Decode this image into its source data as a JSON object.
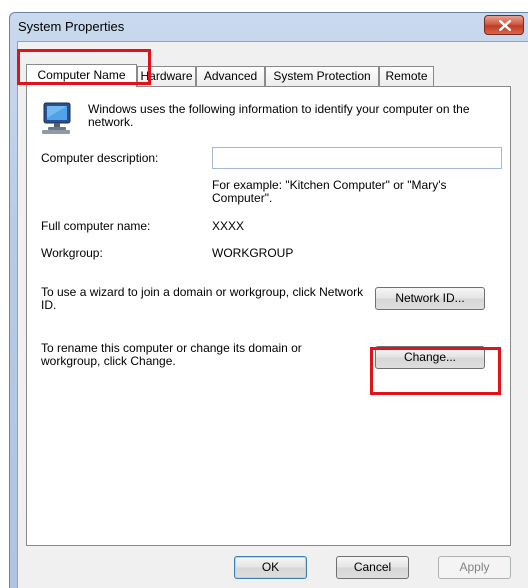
{
  "window": {
    "title": "System Properties"
  },
  "tabs": [
    {
      "label": "Computer Name",
      "active": true
    },
    {
      "label": "Hardware",
      "active": false
    },
    {
      "label": "Advanced",
      "active": false
    },
    {
      "label": "System Protection",
      "active": false
    },
    {
      "label": "Remote",
      "active": false
    }
  ],
  "panel": {
    "intro": "Windows uses the following information to identify your computer on the network.",
    "description_label": "Computer description:",
    "description_value": "",
    "example_text": "For example: \"Kitchen Computer\" or \"Mary's Computer\".",
    "full_name_label": "Full computer name:",
    "full_name_value": "XXXX",
    "workgroup_label": "Workgroup:",
    "workgroup_value": "WORKGROUP",
    "network_id_text": "To use a wizard to join a domain or workgroup, click Network ID.",
    "network_id_button": "Network ID...",
    "rename_text": "To rename this computer or change its domain or workgroup, click Change.",
    "change_button": "Change..."
  },
  "footer": {
    "ok": "OK",
    "cancel": "Cancel",
    "apply": "Apply"
  },
  "colors": {
    "highlight": "#e0121b",
    "close_button": "#c23a24"
  }
}
